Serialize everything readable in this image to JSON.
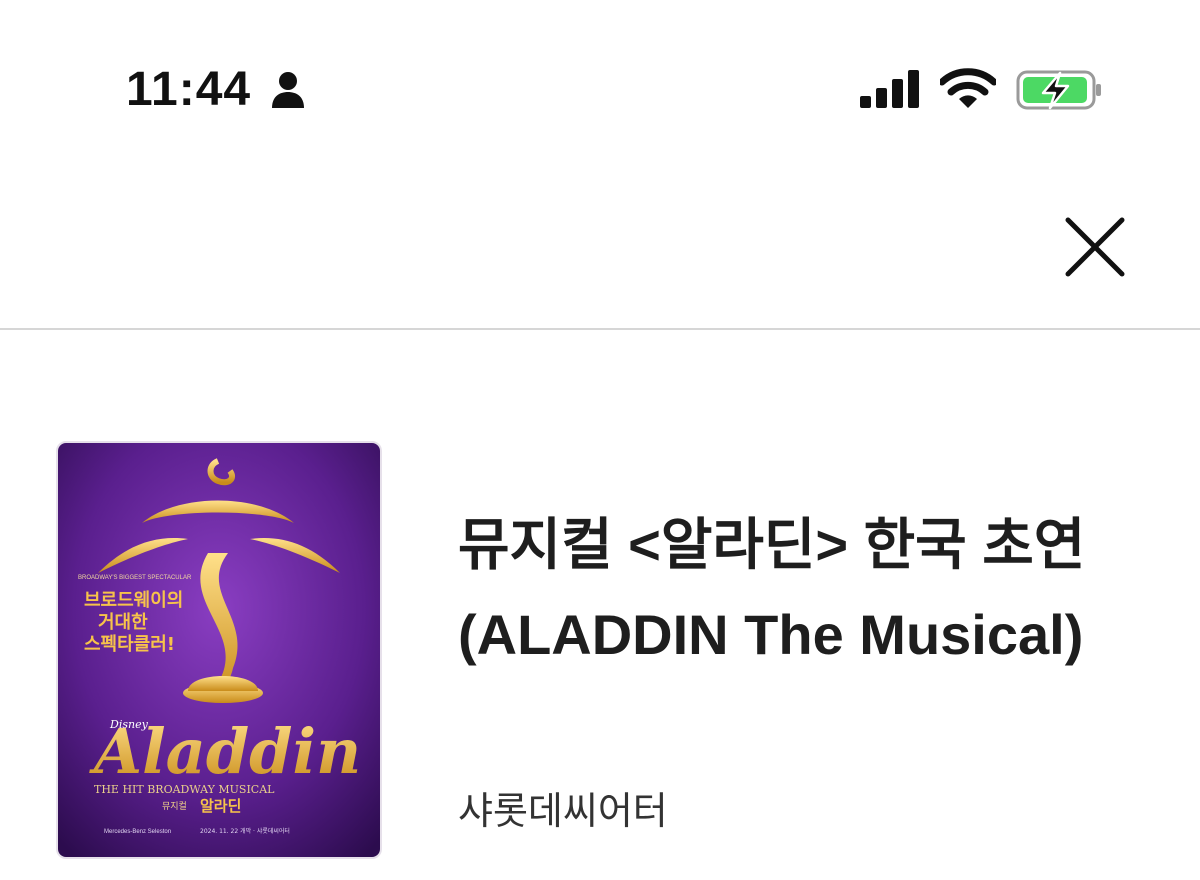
{
  "status_bar": {
    "time": "11:44",
    "icons": [
      "person-icon",
      "signal-icon",
      "wifi-icon",
      "battery-charging-icon"
    ],
    "battery_color": "#4cd964"
  },
  "header": {
    "close_icon": "close-icon"
  },
  "item": {
    "title": "뮤지컬 <알라딘> 한국 초연  (ALADDIN The Musical)",
    "venue": "샤롯데씨어터",
    "poster": {
      "tagline_small": "BROADWAY'S BIGGEST SPECTACULAR",
      "tagline": [
        "브로드웨이의",
        "거대한",
        "스펙타클러!"
      ],
      "brand": "Disney",
      "logo": "Aladdin",
      "subtitle": "THE HIT BROADWAY MUSICAL",
      "korean_title_prefix": "뮤지컬",
      "korean_title": "알라딘",
      "date_line": "2024. 11. 22 개막 · 샤롯데씨어터",
      "sponsor": "Mercedes-Benz Seleston",
      "background_color": "#5a1f8e",
      "gold_color": "#e8b83a"
    }
  }
}
